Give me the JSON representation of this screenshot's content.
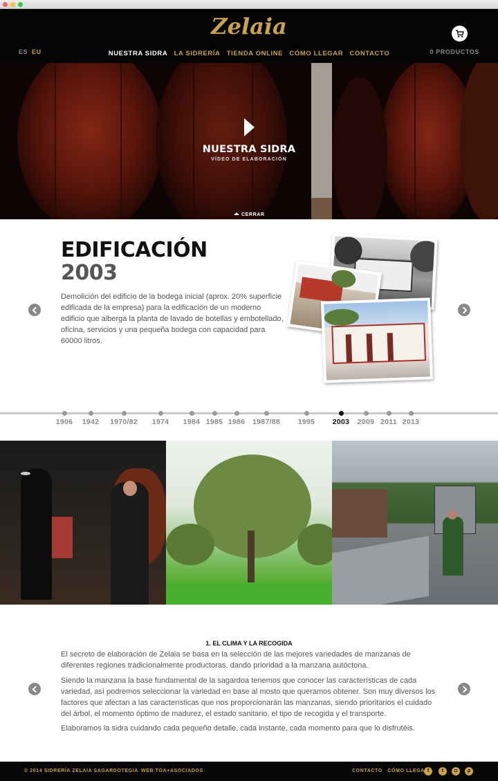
{
  "header": {
    "logo": "Zelaia",
    "lang_es": "ES",
    "lang_eu": "EU",
    "nav": [
      "NUESTRA SIDRA",
      "LA SIDRERÍA",
      "TIENDA ONLINE",
      "CÓMO LLEGAR",
      "CONTACTO"
    ],
    "nav_active_index": 0,
    "products": "0 PRODUCTOS",
    "cart_icon": "cart-icon"
  },
  "hero": {
    "title": "NUESTRA SIDRA",
    "subtitle": "VÍDEO DE ELABORACIÓN",
    "close": "CERRAR",
    "play_icon": "play-icon"
  },
  "history": {
    "title": "EDIFICACIÓN",
    "year": "2003",
    "text": "Demolición del edificio de la bodega inicial (aprox. 20% superficie edificada de la empresa) para la edificación de un moderno edificio que alberga la planta de lavado de botellas y embotellado, oficina, servicios y una pequeña bodega con capacidad para 60000 litros."
  },
  "timeline": {
    "years": [
      "1906",
      "1942",
      "1970/82",
      "1974",
      "1984",
      "1985",
      "1986",
      "1987/88",
      "1995",
      "2003",
      "2009",
      "2011",
      "2013"
    ],
    "current": "2003"
  },
  "process": {
    "heading": "1. EL CLIMA Y LA RECOGIDA",
    "paragraphs": [
      "El secreto de elaboración de Zelaia se basa en la selección de las mejores variedades de manzanas de diferentes regiones tradicionalmente productoras, dando prioridad a la manzana autóctona.",
      "Siendo la manzana la base fundamental de la sagardoa tenemos que conocer las características de cada variedad, así podremos seleccionar la variedad en base al mosto que queramos obtener. Son muy diversos los factores que afectan a las características que nos proporcionarán las manzanas, siendo prioritarios el cuidado del árbol, el momento óptimo de madurez, el estado sanitario, el tipo de recogida y el transporte.",
      "Elaboramos la sidra cuidando cada pequeño detalle, cada instante, cada momento para que lo disfrutéis."
    ]
  },
  "footer": {
    "copyright": "© 2014 SIDRERÍA ZELAIA SAGARDOTEGIA",
    "web": "WEB TGA+ASOCIADOS",
    "links": [
      "CONTACTO",
      "CÓMO LLEGAR"
    ],
    "social": [
      "facebook-icon",
      "twitter-icon",
      "instagram-icon",
      "pinterest-icon"
    ]
  },
  "colors": {
    "gold": "#c8a24d",
    "dark": "#050505",
    "text": "#555555"
  }
}
